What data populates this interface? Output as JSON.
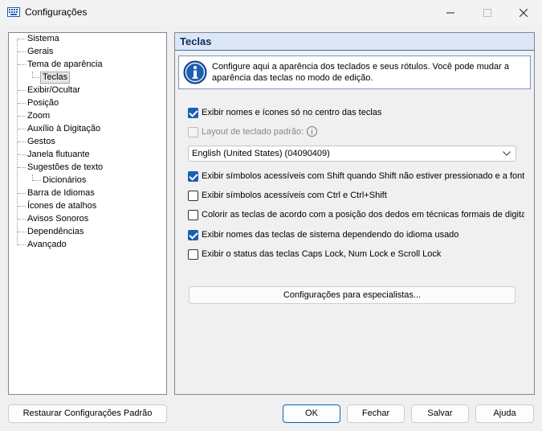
{
  "window": {
    "title": "Configurações"
  },
  "tree": {
    "items": [
      {
        "label": "Sistema"
      },
      {
        "label": "Gerais"
      },
      {
        "label": "Tema de aparência"
      },
      {
        "label": "Teclas"
      },
      {
        "label": "Exibir/Ocultar"
      },
      {
        "label": "Posição"
      },
      {
        "label": "Zoom"
      },
      {
        "label": "Auxílio à Digitação"
      },
      {
        "label": "Gestos"
      },
      {
        "label": "Janela flutuante"
      },
      {
        "label": "Sugestões de texto"
      },
      {
        "label": "Dicionários"
      },
      {
        "label": "Barra de Idiomas"
      },
      {
        "label": "Ícones de atalhos"
      },
      {
        "label": "Avisos Sonoros"
      },
      {
        "label": "Dependências"
      },
      {
        "label": "Avançado"
      }
    ],
    "selected": "Teclas"
  },
  "panel": {
    "title": "Teclas",
    "info": "Configure aqui a aparência dos teclados e seus rótulos. Você pode mudar a aparência das teclas no modo de edição.",
    "options": [
      {
        "label": "Exibir nomes e ícones só no centro das teclas",
        "checked": true,
        "enabled": true
      },
      {
        "label": "Layout de teclado padrão:",
        "checked": false,
        "enabled": false
      },
      {
        "label": "Exibir símbolos acessíveis com Shift quando Shift não estiver pressionado e a fonte não tiver",
        "checked": true,
        "enabled": true
      },
      {
        "label": "Exibir símbolos acessíveis com Ctrl e Ctrl+Shift",
        "checked": false,
        "enabled": true
      },
      {
        "label": "Colorir as teclas de acordo com a posição dos dedos em técnicas formais de digitação",
        "checked": false,
        "enabled": true
      },
      {
        "label": "Exibir nomes das teclas de sistema dependendo do idioma usado",
        "checked": true,
        "enabled": true
      },
      {
        "label": "Exibir o status das teclas Caps Lock, Num Lock e Scroll Lock",
        "checked": false,
        "enabled": true
      }
    ],
    "layout_select": {
      "value": "English (United States) (04090409)"
    },
    "expert_button": "Configurações para especialistas..."
  },
  "buttons": {
    "restore": "Restaurar Configurações Padrão",
    "ok": "OK",
    "close": "Fechar",
    "save": "Salvar",
    "help": "Ajuda"
  }
}
